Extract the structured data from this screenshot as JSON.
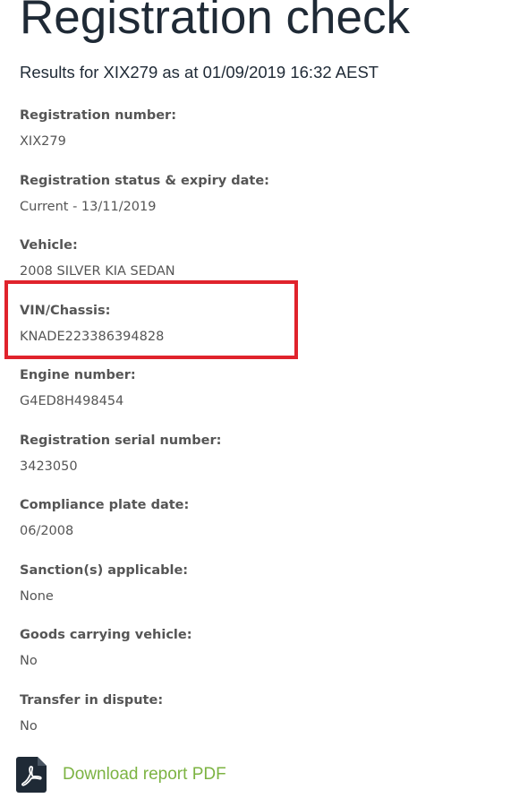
{
  "page": {
    "title": "Registration check",
    "results_line": "Results for XIX279 as at 01/09/2019 16:32 AEST"
  },
  "fields": [
    {
      "label": "Registration number:",
      "value": "XIX279"
    },
    {
      "label": "Registration status & expiry date:",
      "value": "Current - 13/11/2019"
    },
    {
      "label": "Vehicle:",
      "value": "2008 SILVER KIA SEDAN"
    },
    {
      "label": "VIN/Chassis:",
      "value": "KNADE223386394828"
    },
    {
      "label": "Engine number:",
      "value": "G4ED8H498454"
    },
    {
      "label": "Registration serial number:",
      "value": "3423050"
    },
    {
      "label": "Compliance plate date:",
      "value": "06/2008"
    },
    {
      "label": "Sanction(s) applicable:",
      "value": "None"
    },
    {
      "label": "Goods carrying vehicle:",
      "value": "No"
    },
    {
      "label": "Transfer in dispute:",
      "value": "No"
    }
  ],
  "download": {
    "label": "Download report PDF",
    "icon": "pdf-icon"
  },
  "colors": {
    "title": "#1f2a36",
    "text": "#555555",
    "highlight": "#e0232c",
    "link": "#7cb342",
    "icon_bg": "#1f2a36"
  }
}
